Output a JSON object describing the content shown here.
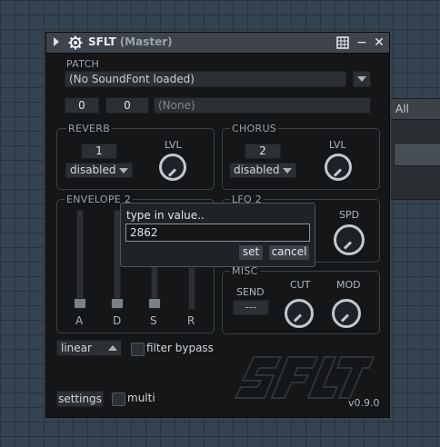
{
  "side_panel": {
    "header": "All"
  },
  "window": {
    "title": "SFLT",
    "subtitle": "(Master)",
    "buttons": {
      "menu_icon": "grid-icon",
      "minimize": "−",
      "close": "✕"
    }
  },
  "patch": {
    "label": "PATCH",
    "soundfont": "(No SoundFont loaded)",
    "bank": "0",
    "program": "0",
    "patch_name": "(None)"
  },
  "reverb": {
    "label": "REVERB",
    "number": "1",
    "mode": "disabled",
    "knob_label": "LVL"
  },
  "chorus": {
    "label": "CHORUS",
    "number": "2",
    "mode": "disabled",
    "knob_label": "LVL"
  },
  "envelope": {
    "label": "ENVELOPE 2",
    "sliders": [
      "A",
      "D",
      "S",
      "R"
    ]
  },
  "lfo": {
    "label": "LFO 2",
    "spd_label": "SPD"
  },
  "misc": {
    "label": "MISC",
    "send_label": "SEND",
    "send_value": "---",
    "cut_label": "CUT",
    "mod_label": "MOD"
  },
  "bottom": {
    "curve": "linear",
    "filter_bypass": "filter bypass",
    "settings": "settings",
    "multi": "multi",
    "logo": "SFLT",
    "version": "v0.9.0"
  },
  "popup": {
    "title": "type in value..",
    "value": "2862",
    "set": "set",
    "cancel": "cancel"
  }
}
